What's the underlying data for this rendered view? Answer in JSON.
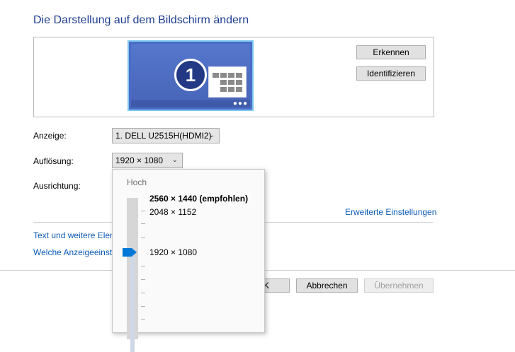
{
  "page_title": "Die Darstellung auf dem Bildschirm ändern",
  "monitor": {
    "number": "1",
    "dots_icon": "ellipsis-icon"
  },
  "buttons": {
    "detect": "Erkennen",
    "identify": "Identifizieren",
    "ok": "K",
    "cancel": "Abbrechen",
    "apply": "Übernehmen"
  },
  "fields": {
    "display_label": "Anzeige:",
    "display_value": "1. DELL U2515H(HDMI2)",
    "resolution_label": "Auflösung:",
    "resolution_value": "1920 × 1080",
    "orientation_label": "Ausrichtung:"
  },
  "links": {
    "advanced": "Erweiterte Einstellungen",
    "text_size": "Text und weitere Elem",
    "which_settings": "Welche Anzeigeeinste"
  },
  "resolution_popup": {
    "top_label": "Hoch",
    "options": [
      {
        "label": "2560 × 1440 (empfohlen)"
      },
      {
        "label": "2048 × 1152"
      },
      {
        "label": "1920 × 1080"
      }
    ],
    "selected": "1920 × 1080",
    "accent_color": "#0078d7"
  }
}
